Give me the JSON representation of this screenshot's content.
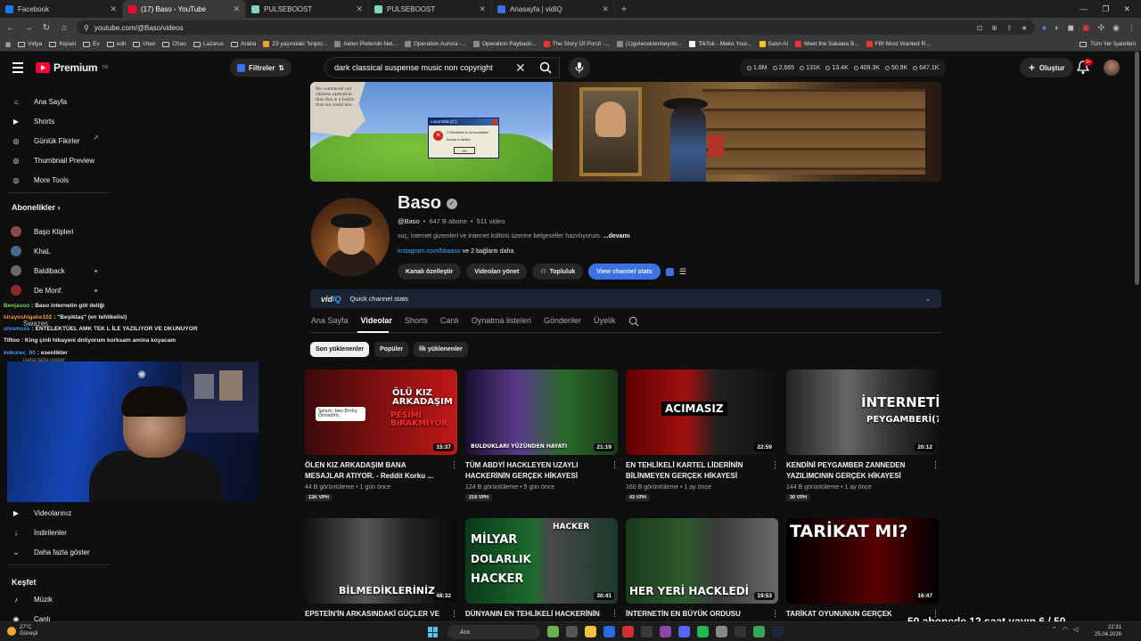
{
  "browser": {
    "tabs": [
      {
        "label": "Facebook",
        "color": "#1877f2",
        "active": false
      },
      {
        "label": "(17) Baso - YouTube",
        "color": "#ff0033",
        "active": true
      },
      {
        "label": "PULSEBOOST",
        "color": "#7fd6c2",
        "active": false
      },
      {
        "label": "PULSEBOOST",
        "color": "#7fd6c2",
        "active": false
      },
      {
        "label": "Anasayfa | vidIQ",
        "color": "#3b73e6",
        "active": false
      }
    ],
    "url": "youtube.com/@Baso/videos",
    "bookmarks": [
      "Vidya",
      "Kişisel",
      "Ev",
      "edit",
      "chan",
      "Chao",
      "Lazarus",
      "Araba",
      "23 yaşındaki \"kripto...",
      "Aiden Pleterski Net...",
      "Operation Aurora -...",
      "Operation Payback...",
      "The Story Of Ponzi -...",
      "(1)gelecektenbeyolc...",
      "TikTok - Make Your...",
      "Satın Al",
      "Meet the Sakawa B...",
      "FBI Most Wanted R..."
    ],
    "bookmarks_end": "Tüm Yer İşaretleri"
  },
  "header": {
    "brand": "Premium",
    "region": "TR",
    "filters_label": "Filtreler",
    "search_query": "dark classical suspense music non copyright",
    "stats": [
      "1.8M",
      "2,665",
      "131K",
      "13.4K",
      "409.3K",
      "50.9K",
      "647.1K"
    ],
    "create_label": "Oluştur",
    "notif_badge": "9+"
  },
  "sidebar": {
    "top_items": [
      {
        "label": "Ana Sayfa",
        "icon": "home-icon"
      },
      {
        "label": "Shorts",
        "icon": "shorts-icon"
      },
      {
        "label": "Günlük Fikirler",
        "icon": "vidiq-icon"
      },
      {
        "label": "Thumbnail Preview",
        "icon": "vidiq-icon"
      },
      {
        "label": "More Tools",
        "icon": "vidiq-icon"
      }
    ],
    "subs_heading": "Abonelikler",
    "subscriptions": [
      {
        "label": "Başo Klipleri",
        "color": "#8a4a4a"
      },
      {
        "label": "KhaL",
        "color": "#4a6a8a"
      },
      {
        "label": "Baldiback",
        "color": "#6a6a6a"
      },
      {
        "label": "De Monf.",
        "color": "#8a2a2a"
      },
      {
        "label": "Swazes",
        "color": "#4a4a4a"
      },
      {
        "label": "Daha fazla göster",
        "color": "#333333"
      }
    ],
    "you_items": [
      {
        "label": "Videolarınız",
        "icon": "your-videos-icon"
      },
      {
        "label": "İndirilenler",
        "icon": "download-icon"
      },
      {
        "label": "Daha fazla göster",
        "icon": "chevron-down-icon"
      }
    ],
    "explore_heading": "Keşfet",
    "explore_items": [
      {
        "label": "Müzik",
        "icon": "music-icon"
      },
      {
        "label": "Canlı",
        "icon": "live-icon"
      }
    ]
  },
  "chat": [
    {
      "user": "Benjasoo",
      "color": "#7ddc5c",
      "msg": ": Baso internetin göt deliği"
    },
    {
      "user": "kirayoshigake102",
      "color": "#f0a030",
      "msg": ": \"Beşiktaş\" (en tehlikelisi)"
    },
    {
      "user": "ulvsmsss",
      "color": "#3ea6ff",
      "msg": ": ENTELEKTÜEL AMK TEK L İLE YAZILIYOR VE OKUNUYOR"
    },
    {
      "user": "Tiftoo",
      "color": "#f1f1f1",
      "msg": ": King çinli hikayeni dnliyorum korksam amina koyacam"
    },
    {
      "user": "kokorec_00",
      "color": "#3ea6ff",
      "msg": ": esenlikler"
    }
  ],
  "banner": {
    "newspaper_text": "We convinced our citizens operation that this is a battle that we could win",
    "dialog_title": "Local Disk (C:)",
    "dialog_line1": "C:\\Restricted is not accessible.",
    "dialog_line2": "Access is denied.",
    "dialog_ok": "OK"
  },
  "channel": {
    "name": "Baso",
    "handle": "@Baso",
    "subscribers": "647 B abone",
    "videos": "511 video",
    "description": "suç, internet gizemleri ve internet kültürü üzerine belgeseller hazırlıyorum.",
    "more": "...devamı",
    "link": "instagram.com/bbaaso",
    "link_more": "ve 2 bağlantı daha",
    "buttons": [
      "Kanalı özelleştir",
      "Videoları yönet",
      "Topluluk",
      "View channel stats"
    ]
  },
  "vidiq_bar": {
    "logo_a": "vid",
    "logo_b": "IQ",
    "label": "Quick channel stats"
  },
  "channel_tabs": [
    "Ana Sayfa",
    "Videolar",
    "Shorts",
    "Canlı",
    "Oynatma listeleri",
    "Gönderiler",
    "Üyelik"
  ],
  "active_tab": "Videolar",
  "chips": [
    "Son yüklenenler",
    "Popüler",
    "İlk yüklenenler"
  ],
  "videos": [
    {
      "title": "ÖLEN KIZ ARKADAŞIM BANA MESAJLAR ATIYOR. - Reddit Korku ...",
      "views": "44 B görüntüleme",
      "age": "1 gün önce",
      "vph": "13K VPH",
      "duration": "15:37",
      "thumb_text": "ÖLÜ KIZ ARKADAŞIM",
      "thumb_text2": "PEŞİMİ BIRAKMIYOR",
      "thumb_text3": "Selam, ben Emily. Ölmedim."
    },
    {
      "title": "TÜM ABDYİ HACKLEYEN UZAYLI HACKERİNİN GERÇEK HİKAYESİ",
      "views": "124 B görüntüleme",
      "age": "5 gün önce",
      "vph": "219 VPH",
      "duration": "21:19",
      "thumb_text": "BULDUKLARI YÜZÜNDEN HAYATI"
    },
    {
      "title": "EN TEHLİKELİ KARTEL LİDERİNİN BİLİNMEYEN GERÇEK HİKAYESİ",
      "views": "160 B görüntüleme",
      "age": "1 ay önce",
      "vph": "43 VPH",
      "duration": "22:59",
      "thumb_text": "ACIMASIZ"
    },
    {
      "title": "KENDİNİ PEYGAMBER ZANNEDEN YAZILIMCININ GERÇEK HİKAYESİ",
      "views": "144 B görüntüleme",
      "age": "1 ay önce",
      "vph": "30 VPH",
      "duration": "20:12",
      "thumb_text": "İNTERNETİN",
      "thumb_text2": "PEYGAMBERİ(?)"
    },
    {
      "title": "EPSTEİN'İN ARKASINDAKİ GÜÇLER VE",
      "duration": "48:32",
      "thumb_text": "BİLMEDİKLERİNİZ.."
    },
    {
      "title": "DÜNYANIN EN TEHLİKELİ HACKERİNİN",
      "duration": "30:41",
      "thumb_text": "MİLYAR",
      "thumb_text2": "DOLARLIK",
      "thumb_text3": "HACKER",
      "thumb_text4": "HACKER"
    },
    {
      "title": "İNTERNETİN EN BÜYÜK ORDUSU",
      "duration": "19:53",
      "thumb_text": "HER YERİ HACKLEDİ"
    },
    {
      "title": "TARİKAT OYUNUNUN GERÇEK",
      "duration": "16:47",
      "thumb_text": "TARİKAT MI?"
    }
  ],
  "taskbar": {
    "temp": "27°C",
    "weather": "Güneşli",
    "search": "Ara",
    "time": "22:31",
    "date": "25.04.2026"
  },
  "stream_goal": "50 abonede 12 saat yayın 6 / 50"
}
